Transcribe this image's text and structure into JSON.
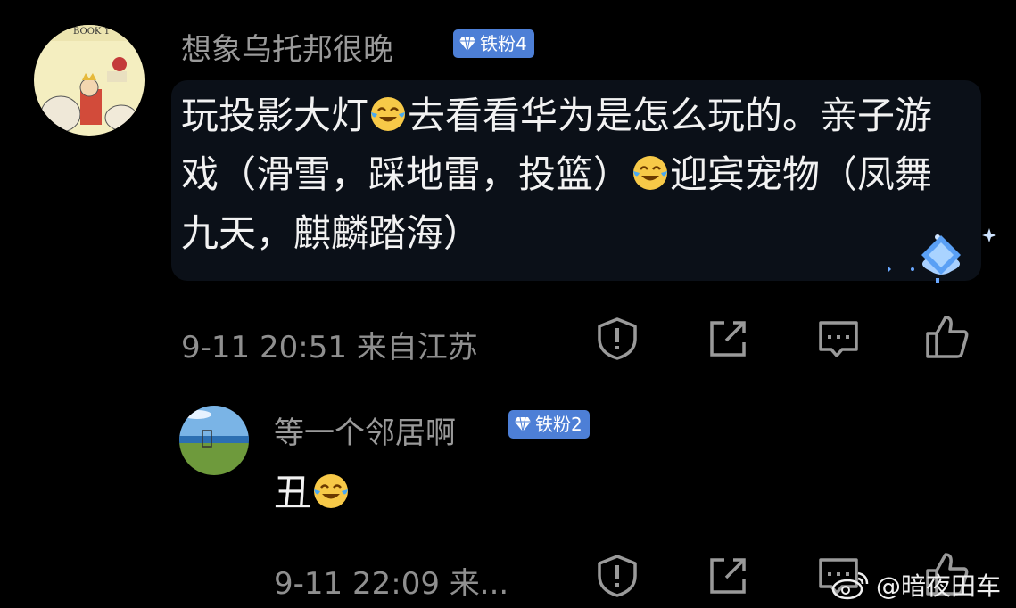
{
  "comment": {
    "username": "想象乌托邦很晚",
    "badge": "铁粉4",
    "text_parts": [
      "玩投影大灯",
      "去看看华为是怎么玩的。亲子游戏（滑雪，踩地雷，投篮）",
      "迎宾宠物（凤舞九天，麒麟踏海）"
    ],
    "emoji": "laugh-cry-emoji",
    "meta": "9-11 20:51 来自江苏"
  },
  "reply": {
    "username": "等一个邻居啊",
    "badge": "铁粉2",
    "text": "丑",
    "emoji": "laugh-cry-emoji",
    "meta": "9-11 22:09 来..."
  },
  "actions": [
    "report-icon",
    "share-icon",
    "comment-icon",
    "like-icon"
  ],
  "watermark": "@暗夜田车",
  "colors": {
    "background": "#000000",
    "badge": "#4d7fd6",
    "username": "#9a9a9a",
    "meta": "#8f8f8f",
    "bubble": "#0b1018"
  }
}
